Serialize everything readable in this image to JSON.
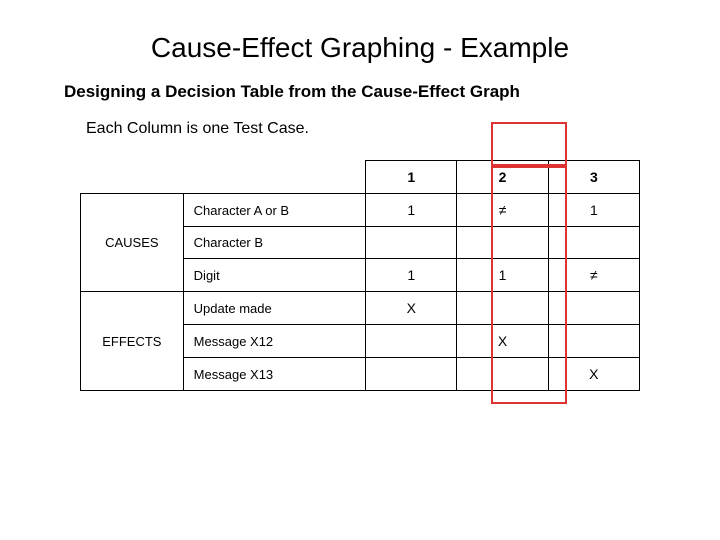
{
  "title": "Cause-Effect Graphing - Example",
  "subtitle": "Designing a Decision Table from the Cause-Effect Graph",
  "caption": "Each Column is one Test Case.",
  "columns": {
    "c1": "1",
    "c2": "2",
    "c3": "3"
  },
  "sections": {
    "causes": "CAUSES",
    "effects": "EFFECTS"
  },
  "rows": {
    "r1": {
      "label": "Character A or B",
      "c1": "1",
      "c2": "≠",
      "c3": "1"
    },
    "r2": {
      "label": "Character B",
      "c1": "",
      "c2": "",
      "c3": ""
    },
    "r3": {
      "label": "Digit",
      "c1": "1",
      "c2": "1",
      "c3": "≠"
    },
    "r4": {
      "label": "Update made",
      "c1": "X",
      "c2": "",
      "c3": ""
    },
    "r5": {
      "label": "Message X12",
      "c1": "",
      "c2": "X",
      "c3": ""
    },
    "r6": {
      "label": "Message X13",
      "c1": "",
      "c2": "",
      "c3": "X"
    }
  }
}
